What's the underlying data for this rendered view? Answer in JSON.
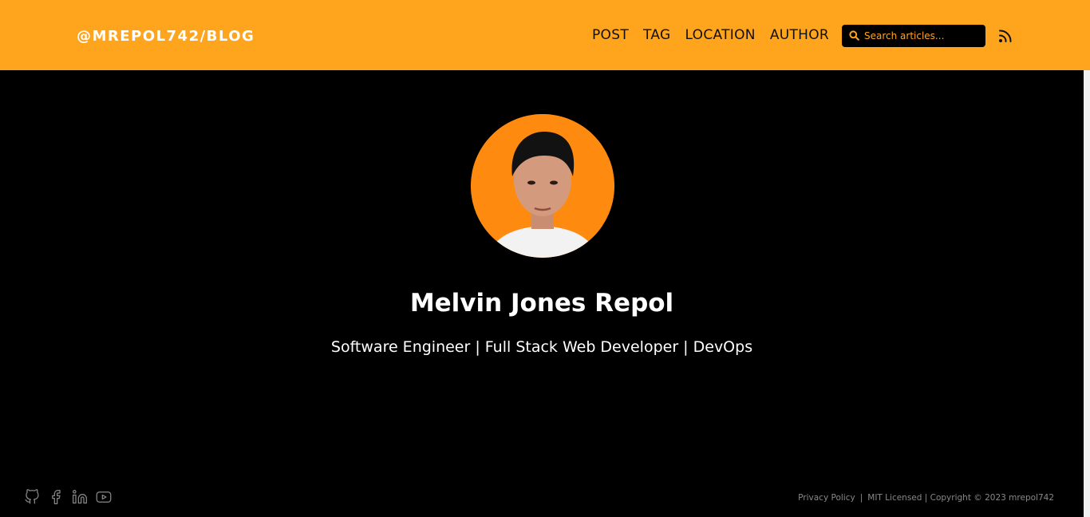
{
  "header": {
    "brand": "@MREPOL742/BLOG",
    "nav": [
      "POST",
      "TAG",
      "LOCATION",
      "AUTHOR"
    ],
    "search_placeholder": "Search articles...",
    "rss_icon": "rss-icon"
  },
  "profile": {
    "name": "Melvin Jones Repol",
    "tagline": "Software Engineer | Full Stack Web Developer | DevOps",
    "avatar_bg": "#ff8a10"
  },
  "footer": {
    "social_icons": [
      "github-icon",
      "facebook-icon",
      "linkedin-icon",
      "youtube-icon"
    ],
    "privacy": "Privacy Policy",
    "separator": "|",
    "license": "MIT Licensed | Copyright © 2023 mrepol742"
  },
  "colors": {
    "accent": "#ffa41d",
    "background": "#000000"
  }
}
